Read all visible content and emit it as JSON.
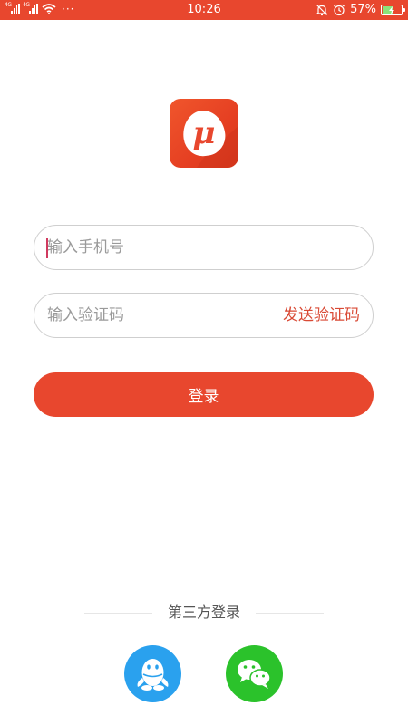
{
  "status_bar": {
    "network_left": "4G",
    "network_right": "4G",
    "overflow": "···",
    "time": "10:26",
    "battery": "57%",
    "battery_level": 0.57,
    "icons": [
      "signal-icon",
      "wifi-icon",
      "mute-icon",
      "alarm-icon",
      "battery-charging-icon"
    ]
  },
  "logo": {
    "glyph": "μ",
    "icon": "app-logo-icon"
  },
  "login_form": {
    "phone_placeholder": "输入手机号",
    "phone_value": "",
    "code_placeholder": "输入验证码",
    "code_value": "",
    "send_code_label": "发送验证码",
    "login_label": "登录"
  },
  "third_party": {
    "title": "第三方登录",
    "providers": [
      {
        "icon": "qq-icon",
        "color": "#2aa1ee"
      },
      {
        "icon": "wechat-icon",
        "color": "#2bc22b"
      }
    ]
  },
  "colors": {
    "accent": "#e8472e",
    "link": "#d94a35"
  }
}
